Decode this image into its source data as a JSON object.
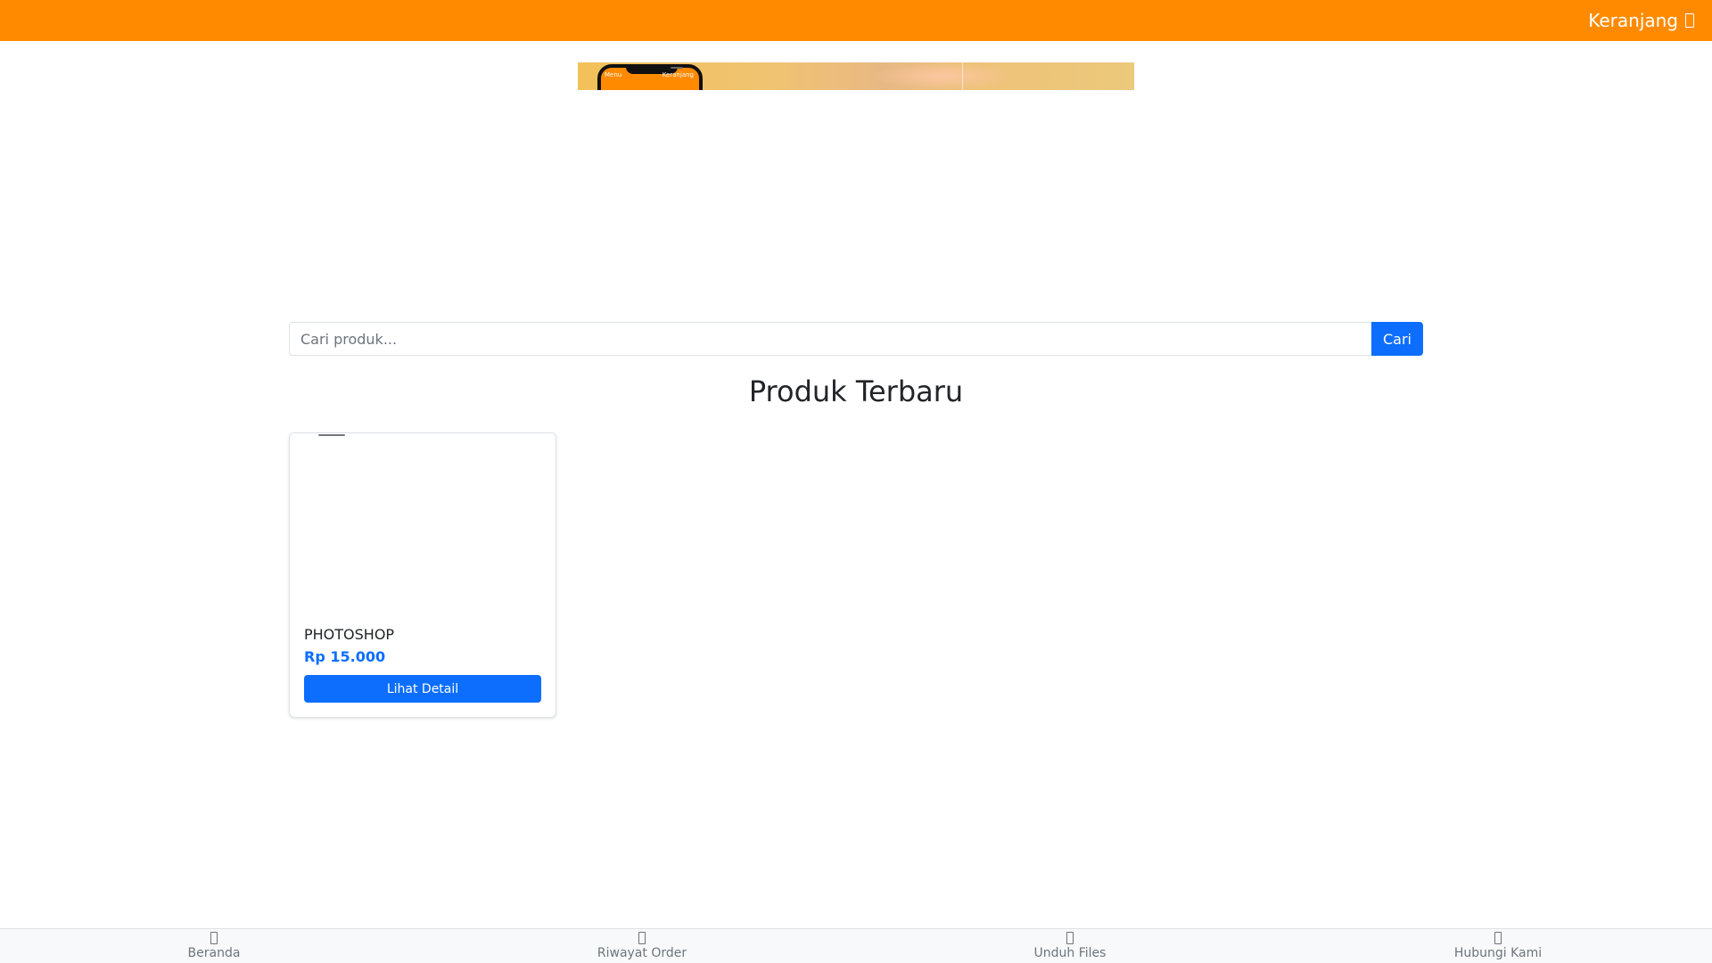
{
  "header": {
    "cart_label": "Keranjang",
    "cart_icon": "shopping-cart-icon",
    "background_color": "#ff8a00"
  },
  "banner": {
    "phone_left_text": "Menu",
    "phone_right_text": "Keranjang"
  },
  "search": {
    "placeholder": "Cari produk...",
    "value": "",
    "button_label": "Cari"
  },
  "section": {
    "title": "Produk Terbaru"
  },
  "products": [
    {
      "name": "PHOTOSHOP",
      "price": "Rp 15.000",
      "button_label": "Lihat Detail"
    }
  ],
  "bottom_nav": {
    "items": [
      {
        "label": "Beranda",
        "icon": "home-icon"
      },
      {
        "label": "Riwayat Order",
        "icon": "history-icon"
      },
      {
        "label": "Unduh Files",
        "icon": "download-icon"
      },
      {
        "label": "Hubungi Kami",
        "icon": "contact-icon"
      }
    ]
  },
  "colors": {
    "primary": "#0d6efd",
    "accent": "#ff8a00"
  }
}
